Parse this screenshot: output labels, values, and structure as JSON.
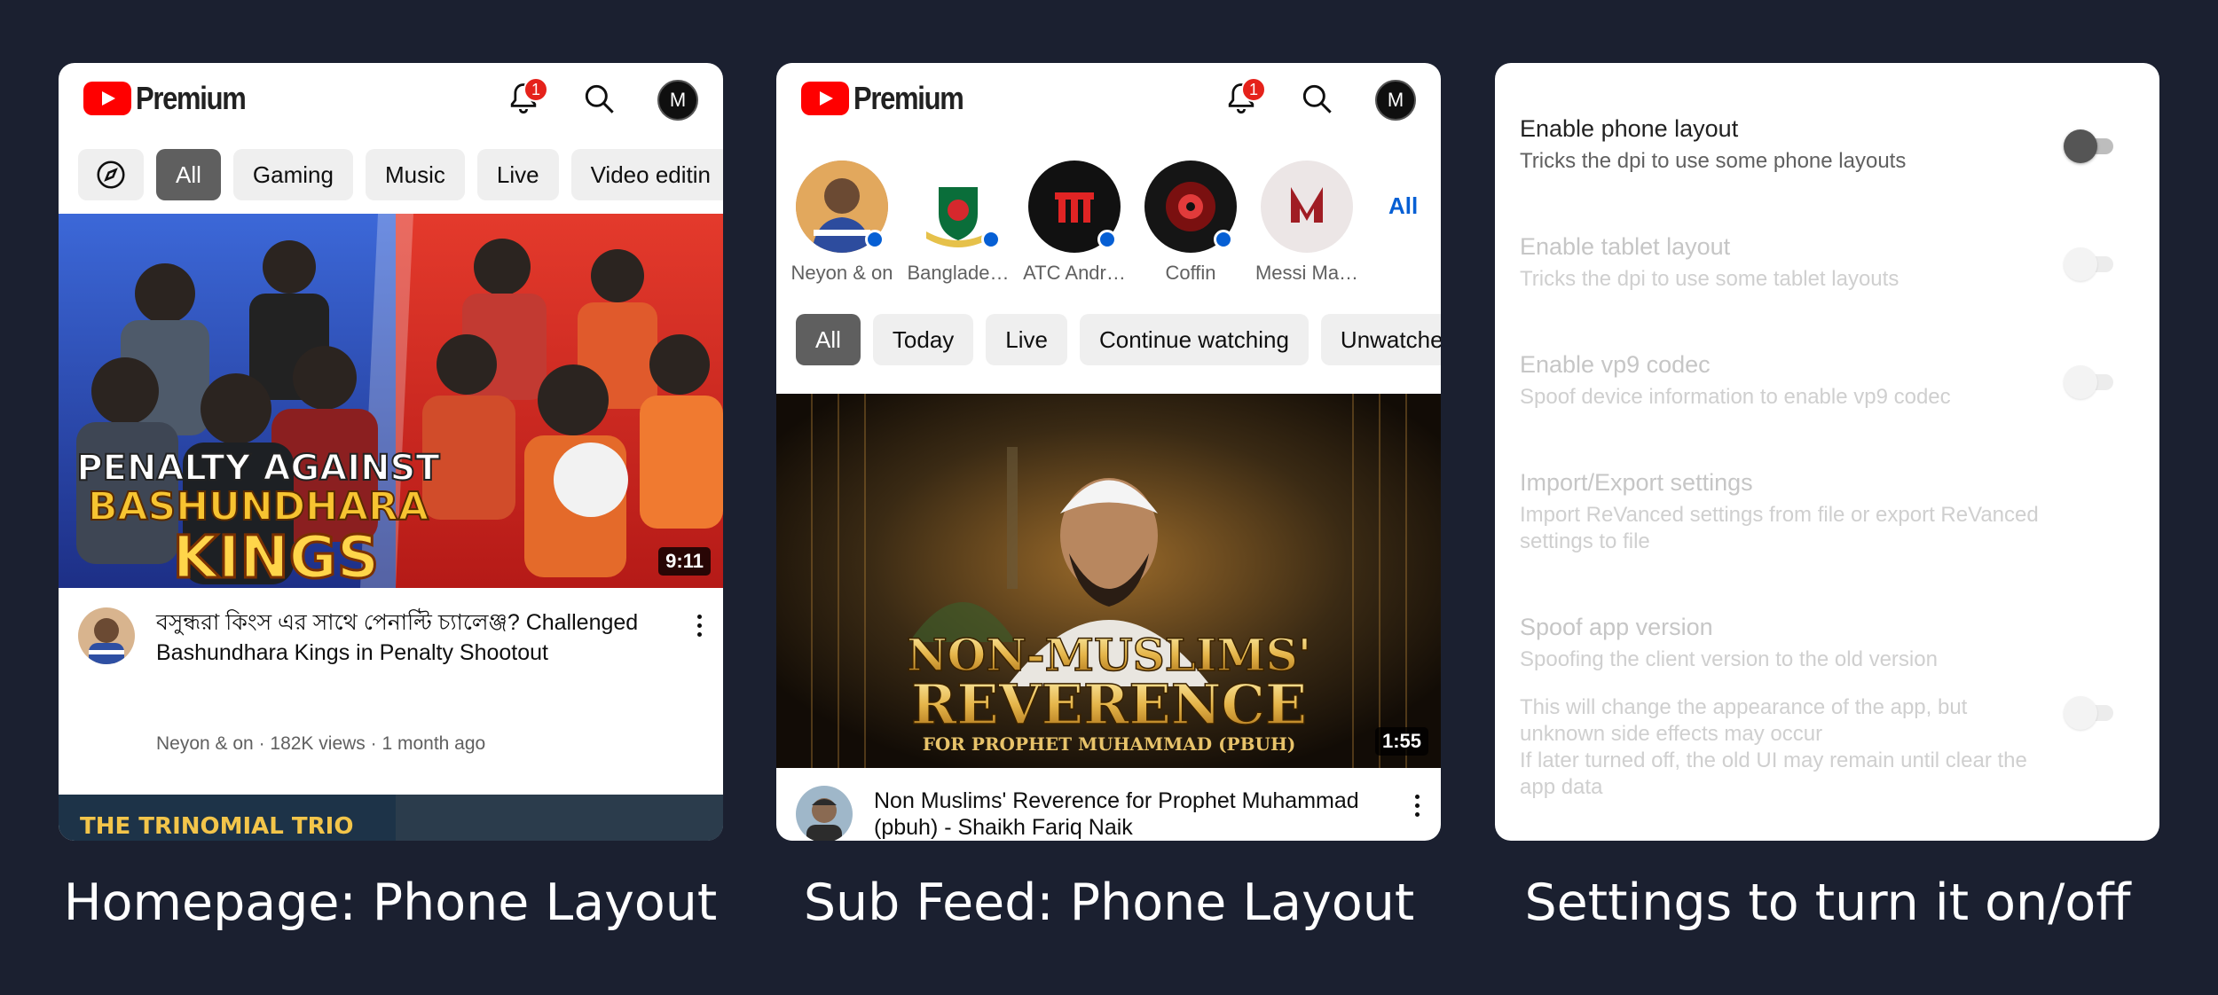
{
  "panels": {
    "home": {
      "logo_text": "Premium",
      "notification_count": "1",
      "avatar_letter": "M",
      "chips": [
        "All",
        "Gaming",
        "Music",
        "Live",
        "Video editin"
      ],
      "video1": {
        "duration": "9:11",
        "thumb_text_top": "PENALTY AGAINST",
        "thumb_text_mid": "BASHUNDHARA",
        "thumb_text_bottom": "KINGS",
        "title": "বসুন্ধরা কিংস এর সাথে পেনাল্টি চ্যালেঞ্জ? Challenged Bashundhara Kings in Penalty Shootout",
        "channel_meta": "Neyon & on · 182K views · 1 month ago"
      },
      "video2": {
        "thumb_text": "THE TRINOMIAL TRIO"
      }
    },
    "subfeed": {
      "logo_text": "Premium",
      "notification_count": "1",
      "avatar_letter": "M",
      "subscriptions": [
        {
          "name": "Neyon & on"
        },
        {
          "name": "Banglade…"
        },
        {
          "name": "ATC Andr…"
        },
        {
          "name": "Coffin"
        },
        {
          "name": "Messi Ma…"
        }
      ],
      "all_label": "All",
      "chips": [
        "All",
        "Today",
        "Live",
        "Continue watching",
        "Unwatched"
      ],
      "video": {
        "duration": "1:55",
        "thumb_text_1": "NON-MUSLIMS'",
        "thumb_text_2": "REVERENCE",
        "thumb_text_3": "FOR PROPHET MUHAMMAD (PBUH)",
        "title": "Non Muslims' Reverence for Prophet Muhammad (pbuh) - Shaikh Fariq Naik"
      }
    },
    "settings": {
      "items": [
        {
          "title": "Enable phone layout",
          "desc": "Tricks the dpi to use some phone layouts",
          "enabled": true
        },
        {
          "title": "Enable tablet layout",
          "desc": "Tricks the dpi to use some tablet layouts",
          "enabled": false
        },
        {
          "title": "Enable vp9 codec",
          "desc": "Spoof device information to enable vp9 codec",
          "enabled": false
        },
        {
          "title": "Import/Export settings",
          "desc": "Import ReVanced settings from file or export ReVanced settings to file",
          "enabled": false
        },
        {
          "title": "Spoof app version",
          "desc": "Spoofing the client version to the old version",
          "enabled": false
        }
      ],
      "spoof_note": "This will change the appearance of the app, but unknown side effects may occur\nIf later turned off, the old UI may remain until clear the app data"
    }
  },
  "captions": {
    "home": "Homepage: Phone Layout",
    "subfeed": "Sub Feed: Phone Layout",
    "settings": "Settings to turn it on/off"
  },
  "colors": {
    "background": "#1b2030",
    "youtube_red": "#ff0000",
    "chip_active": "#5f5f5f",
    "link_blue": "#065fd4"
  }
}
